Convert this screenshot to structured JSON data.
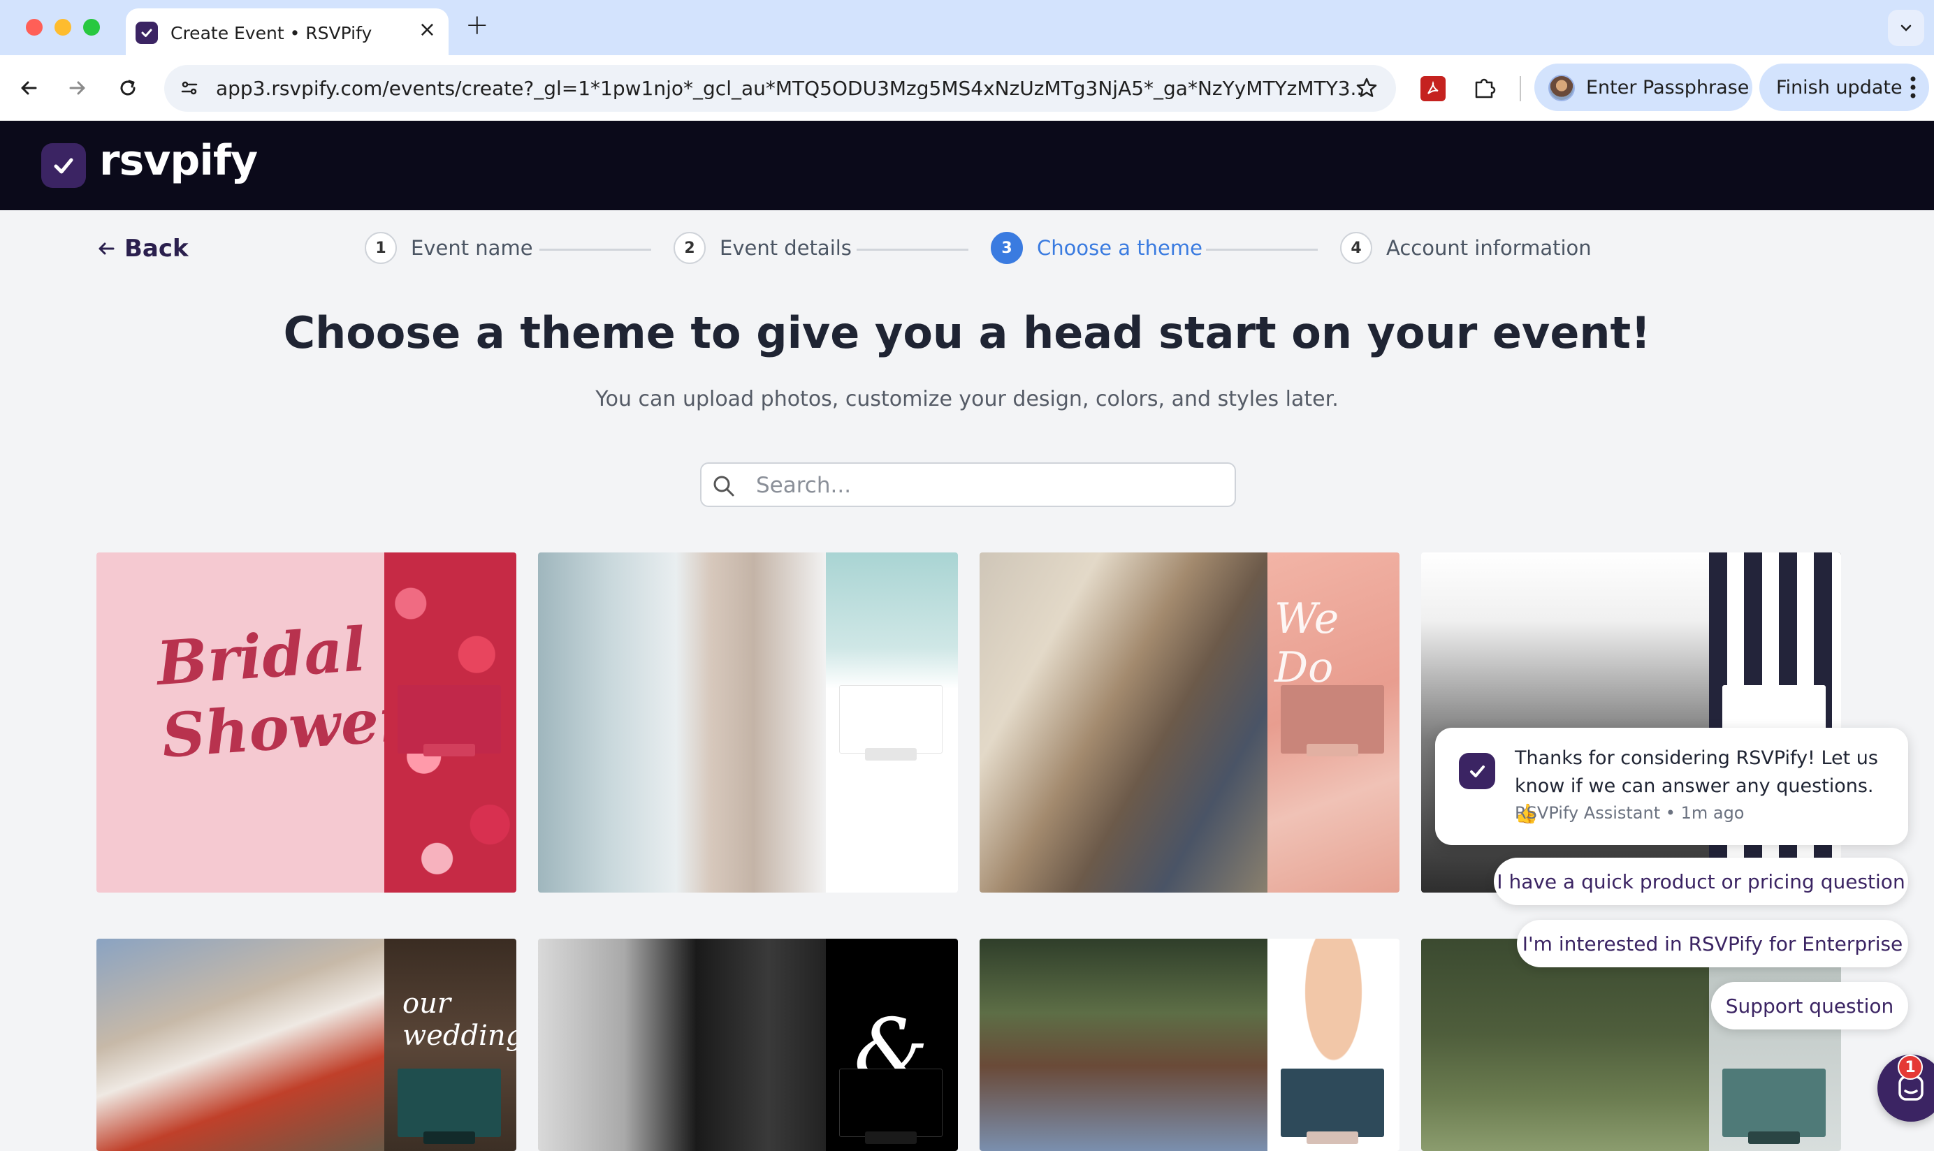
{
  "browser": {
    "tab_title": "Create Event • RSVPify",
    "url": "app3.rsvpify.com/events/create?_gl=1*1pw1njo*_gcl_au*MTQ5ODU3Mzg5MS4xNzUzMTg3NjA5*_ga*NzYyMTYzMTY3...",
    "profile_button": "Enter Passphrase",
    "update_button": "Finish update"
  },
  "app": {
    "logo_text": "rsvpify",
    "brand_color": "#3b2463"
  },
  "stepper": {
    "back_label": "Back",
    "steps": [
      {
        "number": "1",
        "label": "Event name",
        "active": false
      },
      {
        "number": "2",
        "label": "Event details",
        "active": false
      },
      {
        "number": "3",
        "label": "Choose a theme",
        "active": true
      },
      {
        "number": "4",
        "label": "Account information",
        "active": false
      }
    ],
    "active_color": "#3a7be0"
  },
  "page": {
    "headline": "Choose a theme to give you a head start on your event!",
    "subline": "You can upload photos, customize your design, colors, and styles later.",
    "search_placeholder": "Search..."
  },
  "themes": [
    {
      "overlay_text": "Bridal Shower",
      "accent": "#c1284a"
    },
    {
      "overlay_text": "",
      "accent": "#ffffff"
    },
    {
      "overlay_text": "We Do",
      "accent": "#c9857a"
    },
    {
      "overlay_text": "",
      "accent": "#ffffff"
    },
    {
      "overlay_text": "our wedding",
      "accent": "#1f4e4e"
    },
    {
      "overlay_text": "&",
      "accent": "#000000"
    },
    {
      "overlay_text": "",
      "accent": "#2e4a5a"
    },
    {
      "overlay_text": "",
      "accent": "#4f7a78"
    }
  ],
  "chat": {
    "message": "Thanks for considering RSVPify! Let us know if we can answer any questions. 👍",
    "author": "RSVPify Assistant",
    "time": "1m ago",
    "options": [
      "I have a quick product or pricing question",
      "I'm interested in RSVPify for Enterprise",
      "Support question"
    ],
    "unread_count": "1"
  }
}
